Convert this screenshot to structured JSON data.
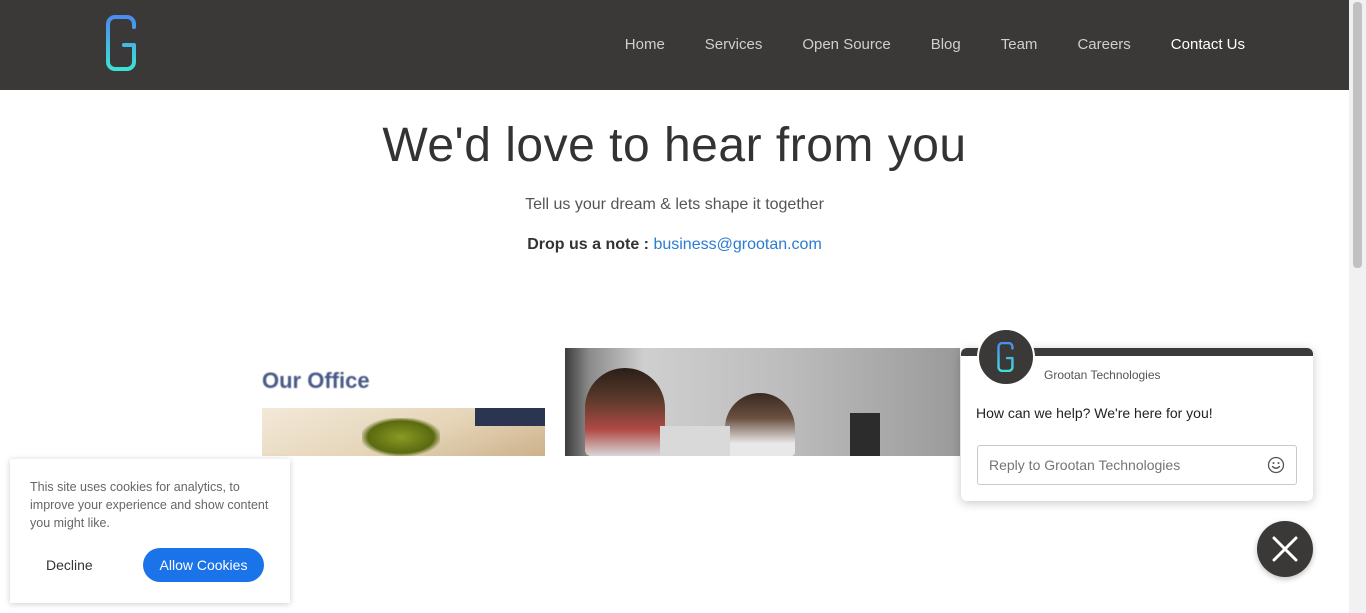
{
  "header": {
    "logo_letter": "G",
    "nav": [
      {
        "label": "Home"
      },
      {
        "label": "Services"
      },
      {
        "label": "Open Source"
      },
      {
        "label": "Blog"
      },
      {
        "label": "Team"
      },
      {
        "label": "Careers"
      },
      {
        "label": "Contact Us",
        "active": true
      }
    ]
  },
  "hero": {
    "title": "We'd love to hear from you",
    "subtitle": "Tell us your dream & lets shape it together",
    "note_label": "Drop us a note :",
    "email": "business@grootan.com"
  },
  "office": {
    "label": "Our Office"
  },
  "chat": {
    "company": "Grootan Technologies",
    "message": "How can we help? We're here for you!",
    "input_placeholder": "Reply to Grootan Technologies",
    "emoji_icon": "smiley-icon",
    "close_icon": "close-icon"
  },
  "cookie": {
    "text": "This site uses cookies for analytics, to improve your experience and show content you might like.",
    "decline_label": "Decline",
    "allow_label": "Allow Cookies"
  },
  "colors": {
    "header_bg": "#3a3937",
    "link": "#2a7bd1",
    "primary_button": "#1a73e8",
    "logo_gradient_start": "#4a8df0",
    "logo_gradient_end": "#3ee0d8"
  }
}
